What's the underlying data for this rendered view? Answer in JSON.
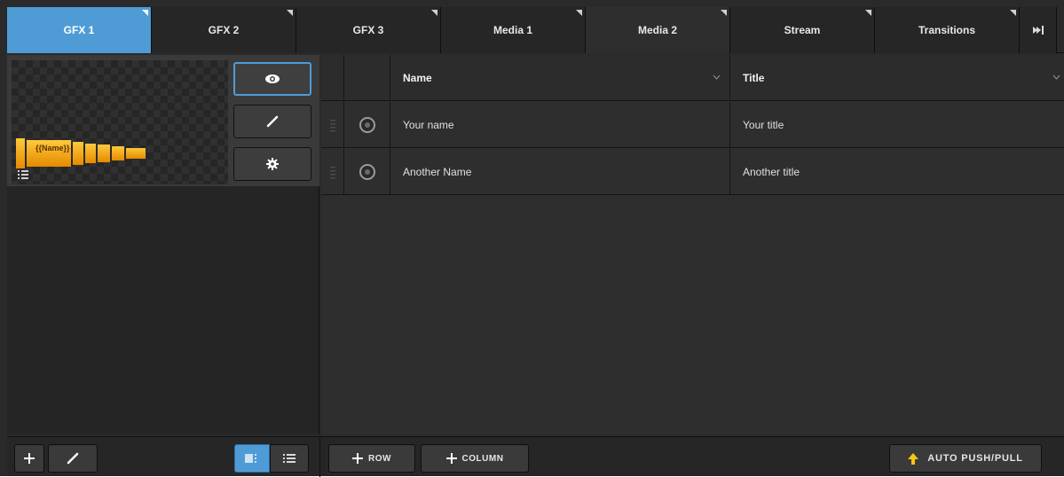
{
  "tabs": [
    {
      "label": "GFX 1",
      "active": true
    },
    {
      "label": "GFX 2",
      "active": false
    },
    {
      "label": "GFX 3",
      "active": false
    },
    {
      "label": "Media 1",
      "active": false
    },
    {
      "label": "Media 2",
      "active": false
    },
    {
      "label": "Stream",
      "active": false
    },
    {
      "label": "Transitions",
      "active": false
    }
  ],
  "tab_end_icon": "skip-to-end-icon",
  "graphic_item": {
    "thumbnail_text": "{{Name}}",
    "buttons": [
      "eye-icon",
      "pencil-icon",
      "gear-icon"
    ]
  },
  "grid": {
    "columns": [
      "Name",
      "Title"
    ],
    "rows": [
      {
        "name": "Your name",
        "title": "Your title"
      },
      {
        "name": "Another Name",
        "title": "Another title"
      }
    ]
  },
  "toolbar": {
    "add_row_label": "ROW",
    "add_column_label": "COLUMN",
    "auto_push_label": "AUTO PUSH/PULL"
  },
  "colors": {
    "accent": "#4f9bd6",
    "background": "#2a2a2a",
    "lower_third_orange": "#f2a21a",
    "push_arrow": "#f5c518"
  }
}
